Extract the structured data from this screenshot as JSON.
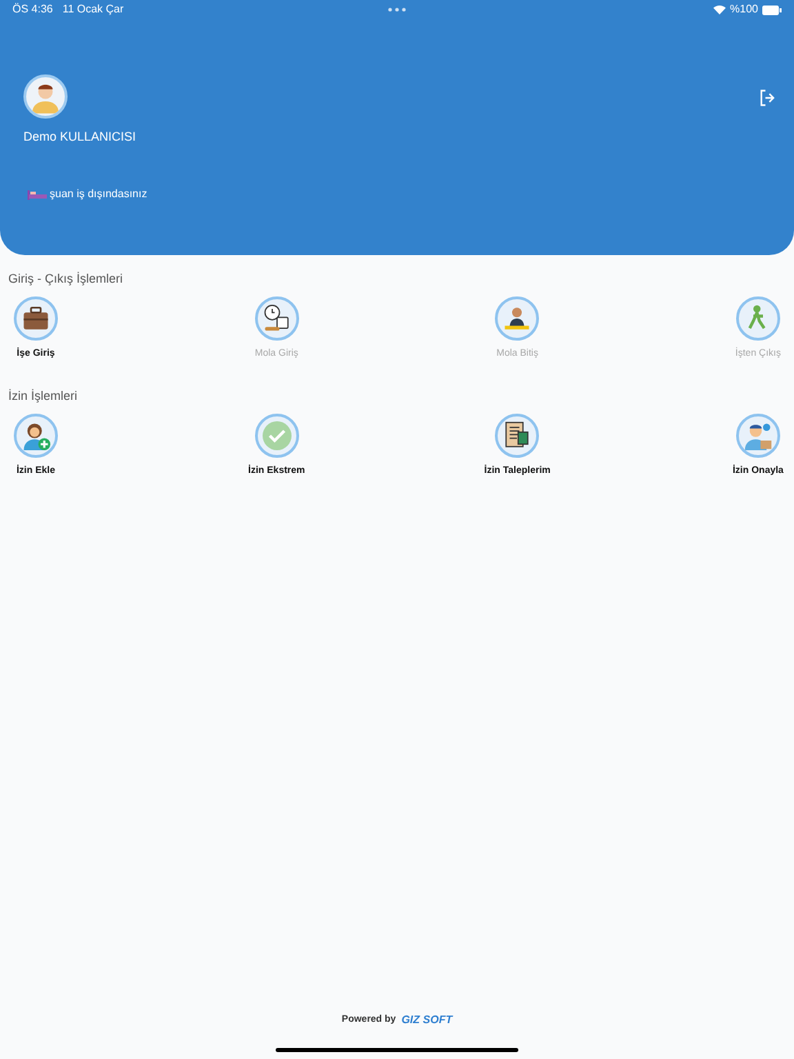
{
  "status_bar": {
    "time": "ÖS 4:36",
    "date": "11 Ocak Çar",
    "battery": "%100"
  },
  "user": {
    "name": "Demo KULLANICISI",
    "status": "şuan iş dışındasınız"
  },
  "sections": [
    {
      "title": "Giriş - Çıkış İşlemleri",
      "items": [
        {
          "kind": "briefcase",
          "label": "İşe Giriş",
          "disabled": false
        },
        {
          "kind": "break-start",
          "label": "Mola Giriş",
          "disabled": true
        },
        {
          "kind": "break-end",
          "label": "Mola Bitiş",
          "disabled": true
        },
        {
          "kind": "exit",
          "label": "İşten Çıkış",
          "disabled": true
        }
      ]
    },
    {
      "title": "İzin İşlemleri",
      "items": [
        {
          "kind": "person-add",
          "label": "İzin Ekle",
          "disabled": false
        },
        {
          "kind": "check",
          "label": "İzin Ekstrem",
          "disabled": false
        },
        {
          "kind": "documents",
          "label": "İzin Taleplerim",
          "disabled": false
        },
        {
          "kind": "approve",
          "label": "İzin Onayla",
          "disabled": false
        }
      ]
    }
  ],
  "footer": {
    "prefix": "Powered by",
    "brand": "GIZ SOFT"
  }
}
